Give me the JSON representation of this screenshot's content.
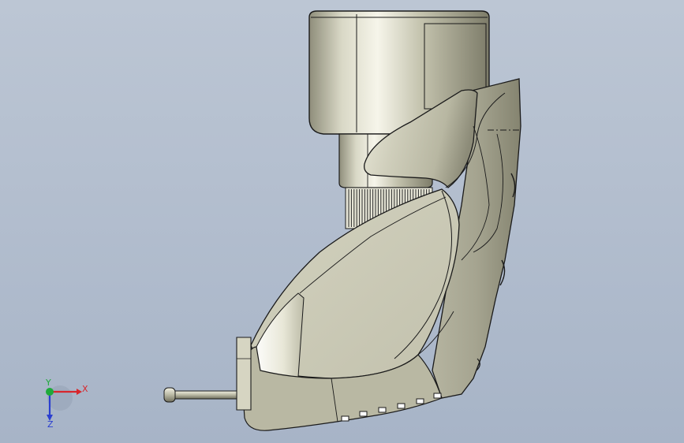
{
  "viewport": {
    "background_top": "#bcc6d4",
    "background_bottom": "#a7b4c7"
  },
  "model": {
    "body_color": "#c9c8b4",
    "edge_color": "#1a1a1a",
    "highlight_color": "#f4f3e6",
    "shadow_color": "#7f7e6c"
  },
  "triad": {
    "x_label": "X",
    "y_label": "Y",
    "z_label": "Z",
    "x_color": "#d8262c",
    "y_color": "#1faa3a",
    "z_color": "#2b3fd0"
  }
}
